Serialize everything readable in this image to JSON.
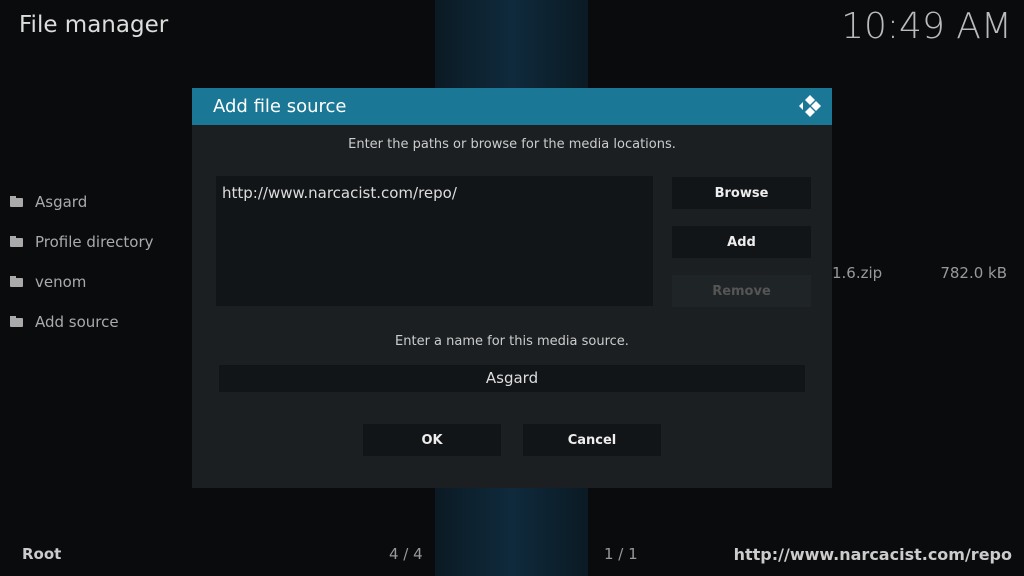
{
  "window": {
    "title": "File manager",
    "clock": "10:49 AM"
  },
  "sidebar": {
    "items": [
      {
        "label": "Asgard",
        "icon": "folder-icon"
      },
      {
        "label": "Profile directory",
        "icon": "folder-icon"
      },
      {
        "label": "venom",
        "icon": "folder-icon"
      },
      {
        "label": "Add source",
        "icon": "folder-icon"
      }
    ]
  },
  "file_row": {
    "name": "1.6.zip",
    "size": "782.0 kB"
  },
  "footer": {
    "left": "Root",
    "count_left": "4 / 4",
    "count_right": "1 / 1",
    "path": "http://www.narcacist.com/repo"
  },
  "dialog": {
    "title": "Add file source",
    "paths_label": "Enter the paths or browse for the media locations.",
    "paths": [
      "http://www.narcacist.com/repo/"
    ],
    "browse": "Browse",
    "add": "Add",
    "remove": "Remove",
    "name_label": "Enter a name for this media source.",
    "name_value": "Asgard",
    "ok": "OK",
    "cancel": "Cancel",
    "accent": "#1a7795"
  }
}
